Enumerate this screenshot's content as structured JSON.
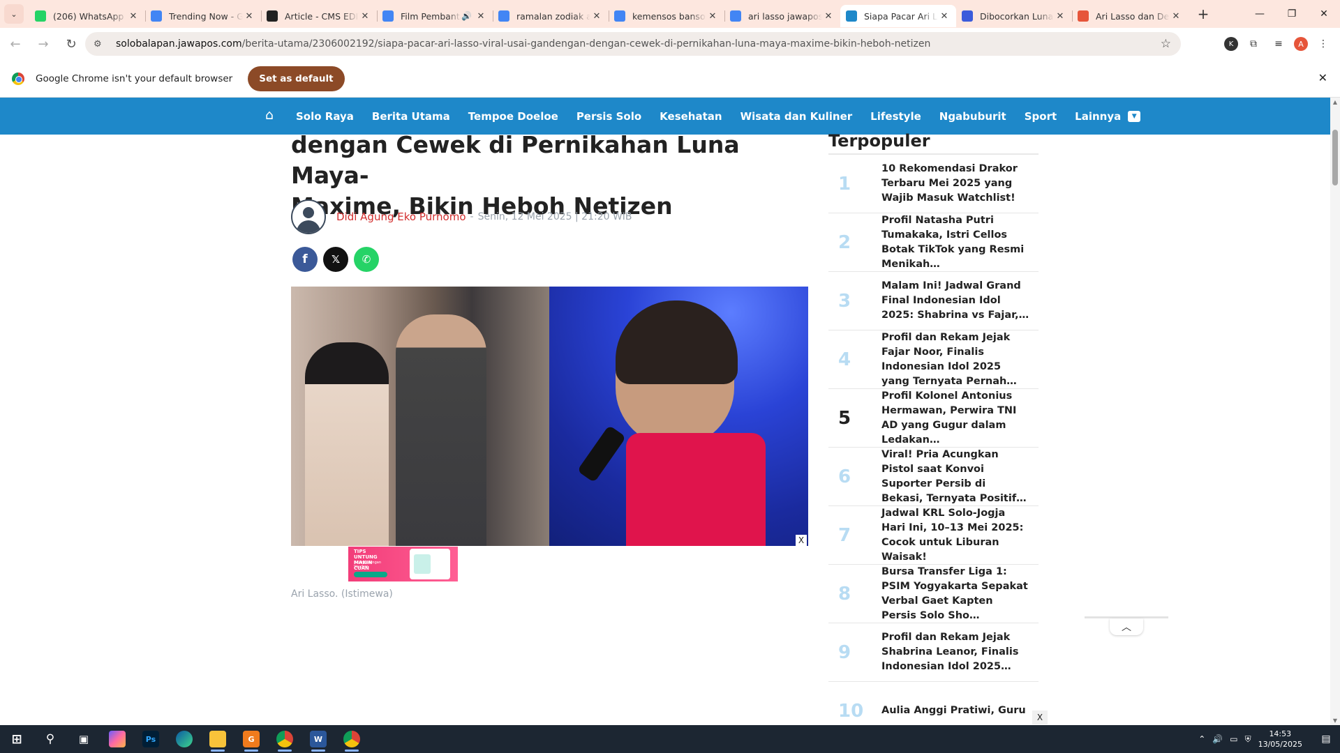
{
  "browser": {
    "tabs": [
      {
        "title": "(206) WhatsApp",
        "favicon": "whatsapp-icon",
        "color": "#25d366",
        "active": false
      },
      {
        "title": "Trending Now - Google Trends",
        "favicon": "trends-icon",
        "color": "#4285f4",
        "active": false
      },
      {
        "title": "Article - CMS EDITOR",
        "favicon": "cms-icon",
        "color": "#222222",
        "active": false
      },
      {
        "title": "Film Pembantaian",
        "favicon": "doc-icon",
        "color": "#4285f4",
        "active": false,
        "audio": true
      },
      {
        "title": "ramalan zodiak aquarius",
        "favicon": "google-icon",
        "color": "#4285f4",
        "active": false
      },
      {
        "title": "kemensos bansos",
        "favicon": "google-icon",
        "color": "#4285f4",
        "active": false
      },
      {
        "title": "ari lasso jawapos",
        "favicon": "google-icon",
        "color": "#4285f4",
        "active": false
      },
      {
        "title": "Siapa Pacar Ari Lasso",
        "favicon": "jawapos-icon",
        "color": "#1e88c9",
        "active": true
      },
      {
        "title": "Dibocorkan Luna Maya",
        "favicon": "news-icon",
        "color": "#3b5bdb",
        "active": false
      },
      {
        "title": "Ari Lasso dan Dearly",
        "favicon": "kompas-icon",
        "color": "#e6553a",
        "active": false
      }
    ],
    "new_tab": "+",
    "url_host": "solobalapan.jawapos.com",
    "url_path": "/berita-utama/2306002192/siapa-pacar-ari-lasso-viral-usai-gandengan-dengan-cewek-di-pernikahan-luna-maya-maxime-bikin-heboh-netizen",
    "profile_initial": "A",
    "ext_initial": "K"
  },
  "infobar": {
    "message": "Google Chrome isn't your default browser",
    "button": "Set as default"
  },
  "site_nav": {
    "items": [
      "Solo Raya",
      "Berita Utama",
      "Tempoe Doeloe",
      "Persis Solo",
      "Kesehatan",
      "Wisata dan Kuliner",
      "Lifestyle",
      "Ngabuburit",
      "Sport"
    ],
    "more": "Lainnya"
  },
  "article": {
    "headline_line1": "dengan Cewek di Pernikahan Luna Maya-",
    "headline_line2": "Maxime, Bikin Heboh Netizen",
    "author": "Didi Agung Eko Purnomo",
    "separator": "-",
    "date": "Senin, 12 Mei 2025 | 21:20 WIB",
    "caption": "Ari Lasso. (Istimewa)",
    "close_x": "X"
  },
  "ad": {
    "headline": "TIPS UNTUNG MAKIN CUAN",
    "sub": "Belanja dengan Voucher"
  },
  "sidebar": {
    "title": "Terpopuler",
    "items": [
      {
        "num": "1",
        "text": "10 Rekomendasi Drakor Terbaru Mei 2025 yang Wajib Masuk Watchlist!"
      },
      {
        "num": "2",
        "text": "Profil Natasha Putri Tumakaka, Istri Cellos Botak TikTok yang Resmi Menikah…"
      },
      {
        "num": "3",
        "text": "Malam Ini! Jadwal Grand Final Indonesian Idol 2025: Shabrina vs Fajar,…"
      },
      {
        "num": "4",
        "text": "Profil dan Rekam Jejak Fajar Noor, Finalis Indonesian Idol 2025 yang Ternyata Pernah…"
      },
      {
        "num": "5",
        "text": "Profil Kolonel Antonius Hermawan, Perwira TNI AD yang Gugur dalam Ledakan…"
      },
      {
        "num": "6",
        "text": "Viral! Pria Acungkan Pistol saat Konvoi Suporter Persib di Bekasi, Ternyata Positif…"
      },
      {
        "num": "7",
        "text": "Jadwal KRL Solo-Jogja Hari Ini, 10–13 Mei 2025: Cocok untuk Liburan Waisak!"
      },
      {
        "num": "8",
        "text": "Bursa Transfer Liga 1: PSIM Yogyakarta Sepakat Verbal Gaet Kapten Persis Solo Sho…"
      },
      {
        "num": "9",
        "text": "Profil dan Rekam Jejak Shabrina Leanor, Finalis Indonesian Idol 2025…"
      },
      {
        "num": "10",
        "text": "Aulia Anggi Pratiwi, Guru"
      }
    ],
    "close_x": "X"
  },
  "taskbar": {
    "time": "14:53",
    "date": "13/05/2025"
  }
}
